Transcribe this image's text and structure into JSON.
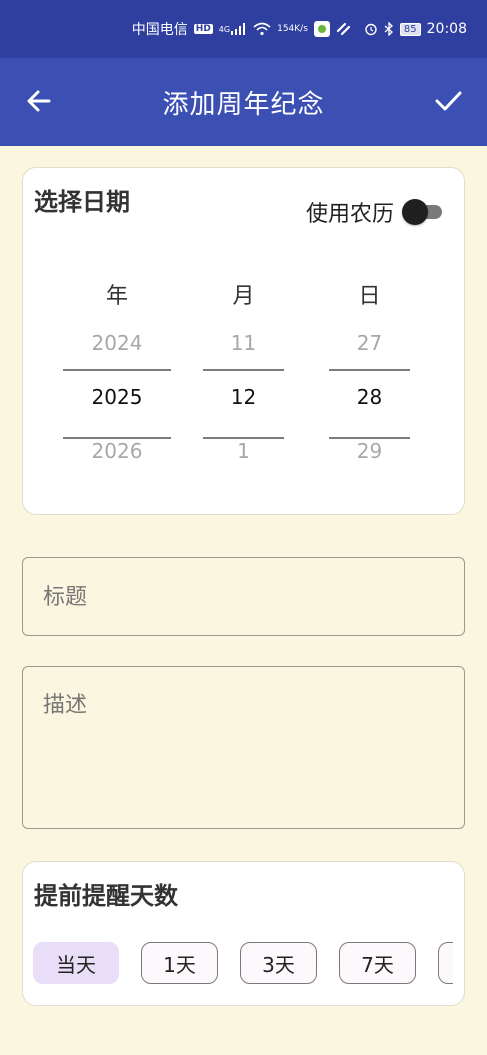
{
  "status_bar": {
    "carrier": "中国电信",
    "hd": "HD",
    "signal": "4G",
    "speed_value": "154",
    "speed_unit": "K/s",
    "battery": "85",
    "time": "20:08"
  },
  "app_bar": {
    "title": "添加周年纪念",
    "back_icon": "arrow-left-icon",
    "confirm_icon": "check-icon"
  },
  "date_card": {
    "title": "选择日期",
    "lunar_label": "使用农历",
    "lunar_enabled": false,
    "year": {
      "header": "年",
      "prev": "2024",
      "selected": "2025",
      "next": "2026"
    },
    "month": {
      "header": "月",
      "prev": "11",
      "selected": "12",
      "next": "1"
    },
    "day": {
      "header": "日",
      "prev": "27",
      "selected": "28",
      "next": "29"
    }
  },
  "title_field": {
    "placeholder": "标题",
    "value": ""
  },
  "description_field": {
    "placeholder": "描述",
    "value": ""
  },
  "remind_card": {
    "title": "提前提醒天数",
    "options": [
      "当天",
      "1天",
      "3天",
      "7天"
    ],
    "selected": "当天"
  },
  "colors": {
    "status_bar": "#2E3F9F",
    "app_bar": "#3C50B4",
    "background": "#FBF6DF",
    "chip_selected": "#E8DEF8"
  }
}
